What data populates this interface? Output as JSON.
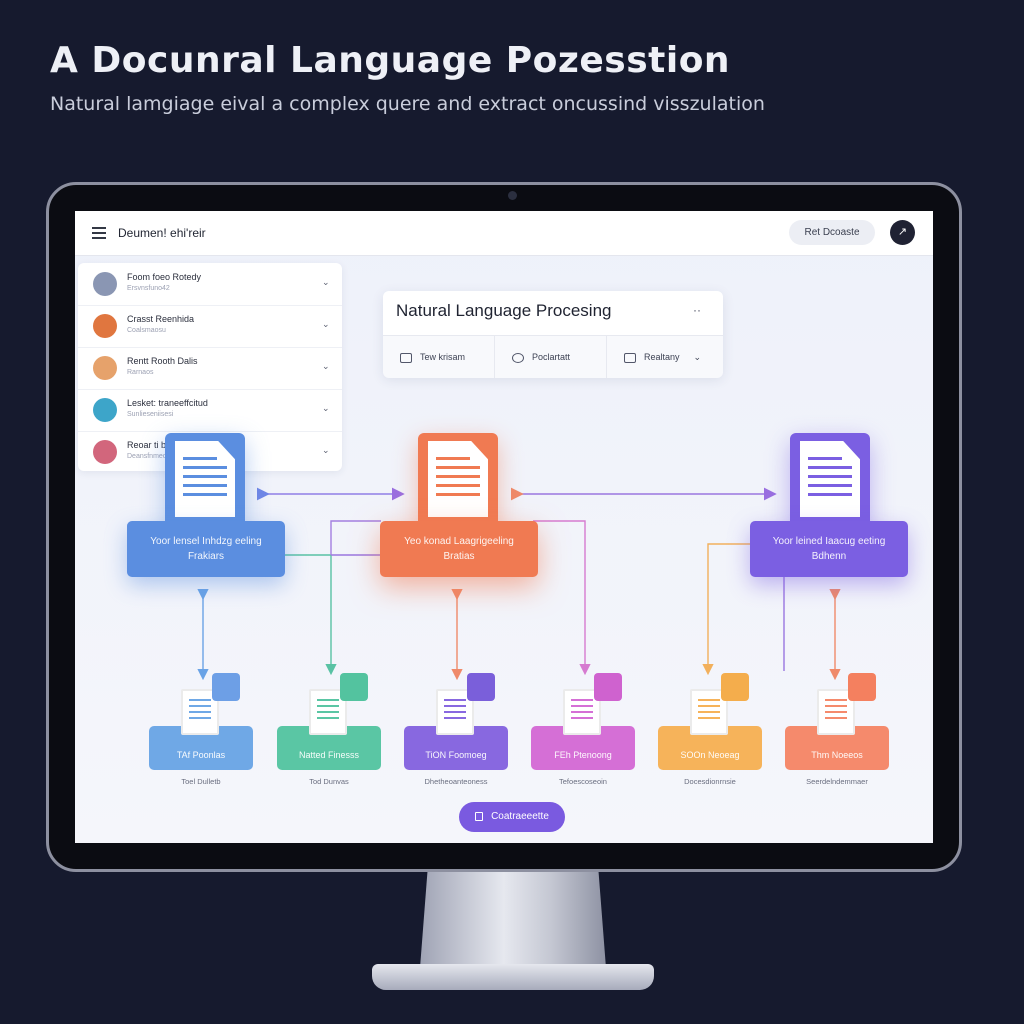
{
  "page": {
    "headline": "A Docunral Language Pozesstion",
    "subheadline": "Natural lamgiage eival a complex quere and extract oncussind visszulation"
  },
  "app": {
    "title": "Deumen! ehi'reir",
    "header_button": "Ret Dcoaste",
    "avatar_glyph": "↗"
  },
  "document_list": [
    {
      "title": "Foom foeo Rotedy",
      "subtitle": "Ersvnsfuno42",
      "avatar_color": "#8a96b3"
    },
    {
      "title": "Crasst Reenhida",
      "subtitle": "Coalsmaosu",
      "avatar_color": "#e0763f"
    },
    {
      "title": "Rentt Rooth Dalis",
      "subtitle": "Rarnaos",
      "avatar_color": "#e6a26b"
    },
    {
      "title": "Lesket: traneeffcitud",
      "subtitle": "Sunlieseniisesi",
      "avatar_color": "#3da5c9"
    },
    {
      "title": "Reoar ti bel",
      "subtitle": "Deansfnmeoo",
      "avatar_color": "#d2667c"
    }
  ],
  "nlp_panel": {
    "title": "Natural Language Procesing",
    "more": "··",
    "tabs": [
      {
        "label": "Tew krisam",
        "icon": "document-icon"
      },
      {
        "label": "Poclartatt",
        "icon": "chat-icon"
      },
      {
        "label": "Realtany",
        "icon": "settings-icon"
      }
    ]
  },
  "pipeline": {
    "top_nodes": [
      {
        "label": "Yoor lensel Inhdzg eeling Frakiars",
        "color": "#5b8ee0"
      },
      {
        "label": "Yeo konad Laagrigeeling Bratias",
        "color": "#f07a52"
      },
      {
        "label": "Yoor leined Iaacug eeting Bdhenn",
        "color": "#7b5fe2"
      }
    ],
    "bottom_nodes": [
      {
        "label": "TAf Poonlas",
        "caption": "Toel Dulletb",
        "color": "#6fa8e6",
        "badge": "#6d9fe6"
      },
      {
        "label": "Natted Finesss",
        "caption": "Tod Dunvas",
        "color": "#5ac6a4",
        "badge": "#53c39f"
      },
      {
        "label": "TiON Foomoeg",
        "caption": "Dhetheoanteoness",
        "color": "#8868e0",
        "badge": "#7a5fda"
      },
      {
        "label": "FEh Ptenoong",
        "caption": "Tefoescoseoin",
        "color": "#d56fd6",
        "badge": "#cf62cf"
      },
      {
        "label": "SOOn Neoeag",
        "caption": "Docesdionrnsie",
        "color": "#f6b35a",
        "badge": "#f4ad4c"
      },
      {
        "label": "Thm Noeeos",
        "caption": "Seerdelndemmaer",
        "color": "#f58a6c",
        "badge": "#f4805f"
      }
    ]
  },
  "cta": {
    "label": "Coatraeeette"
  }
}
